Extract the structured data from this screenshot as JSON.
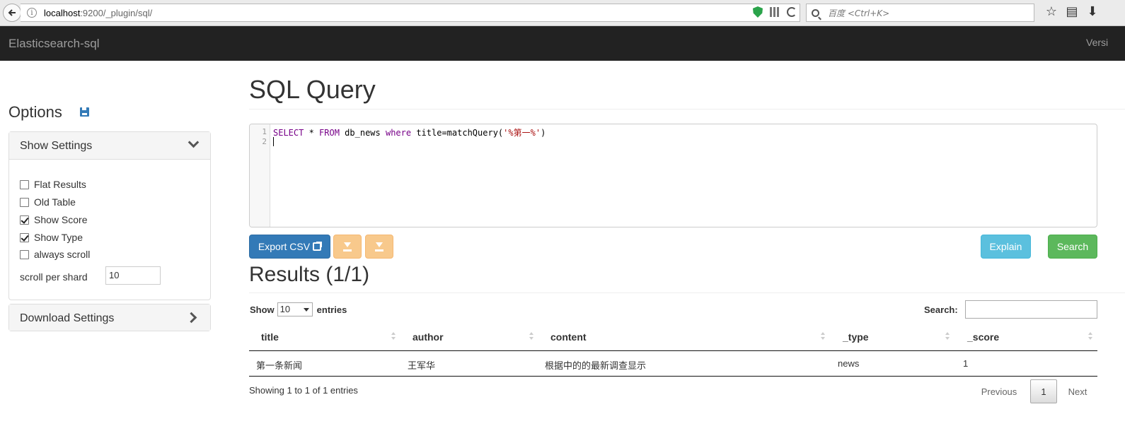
{
  "browser": {
    "url_host": "localhost",
    "url_rest": ":9200/_plugin/sql/",
    "search_placeholder": "百度 <Ctrl+K>"
  },
  "navbar": {
    "brand": "Elasticsearch-sql",
    "right_text": "Versi"
  },
  "options": {
    "title": "Options",
    "show_settings": {
      "title": "Show Settings",
      "checkboxes": [
        {
          "label": "Flat Results",
          "checked": false
        },
        {
          "label": "Old Table",
          "checked": false
        },
        {
          "label": "Show Score",
          "checked": true
        },
        {
          "label": "Show Type",
          "checked": true
        },
        {
          "label": "always scroll",
          "checked": false
        }
      ],
      "scroll_label": "scroll per shard",
      "scroll_value": "10"
    },
    "download_settings": {
      "title": "Download Settings"
    }
  },
  "query": {
    "title": "SQL Query",
    "line_numbers": [
      "1",
      "2"
    ],
    "code": {
      "kw_select": "SELECT",
      "star": " * ",
      "kw_from": "FROM",
      "table": " db_news ",
      "kw_where": "where",
      "cond": " title=matchQuery(",
      "string": "'%第一%'",
      "close": ")"
    }
  },
  "actions": {
    "export": "Export CSV",
    "explain": "Explain",
    "search": "Search"
  },
  "results": {
    "title": "Results (1/1)",
    "show": "Show",
    "entries": "entries",
    "page_length": "10",
    "search_label": "Search:",
    "columns": [
      "title",
      "author",
      "content",
      "_type",
      "_score"
    ],
    "rows": [
      [
        "第一条新闻",
        "王军华",
        "根据中的的最新调查显示",
        "news",
        "1"
      ]
    ],
    "info": "Showing 1 to 1 of 1 entries",
    "pagination": {
      "previous": "Previous",
      "current": "1",
      "next": "Next"
    }
  }
}
